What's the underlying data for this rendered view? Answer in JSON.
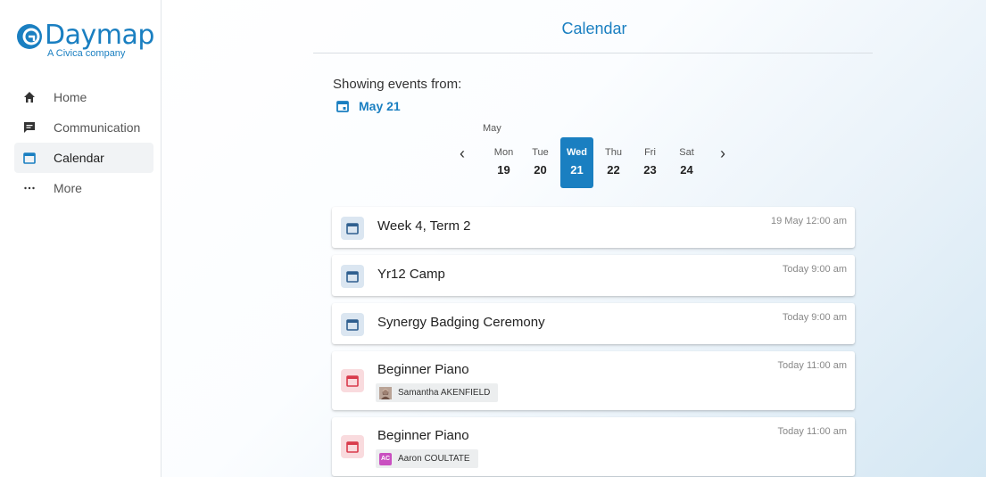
{
  "brand": {
    "name": "Daymap",
    "subtitle": "A Civica company",
    "color": "#1a7fc1"
  },
  "sidebar": {
    "items": [
      {
        "label": "Home",
        "icon": "home-icon",
        "active": false
      },
      {
        "label": "Communication",
        "icon": "message-icon",
        "active": false
      },
      {
        "label": "Calendar",
        "icon": "calendar-icon",
        "active": true
      },
      {
        "label": "More",
        "icon": "more-dots-icon",
        "active": false
      }
    ]
  },
  "main": {
    "title": "Calendar",
    "showing_label": "Showing events from:",
    "selected_date": "May 21",
    "month": "May",
    "days": [
      {
        "name": "Mon",
        "date": "19",
        "selected": false
      },
      {
        "name": "Tue",
        "date": "20",
        "selected": false
      },
      {
        "name": "Wed",
        "date": "21",
        "selected": true
      },
      {
        "name": "Thu",
        "date": "22",
        "selected": false
      },
      {
        "name": "Fri",
        "date": "23",
        "selected": false
      },
      {
        "name": "Sat",
        "date": "24",
        "selected": false
      }
    ],
    "prev_label": "‹",
    "next_label": "›",
    "events": [
      {
        "title": "Week 4, Term 2",
        "time": "19 May 12:00 am",
        "color": "blue"
      },
      {
        "title": "Yr12 Camp",
        "time": "Today 9:00 am",
        "color": "blue"
      },
      {
        "title": "Synergy Badging Ceremony",
        "time": "Today 9:00 am",
        "color": "blue"
      },
      {
        "title": "Beginner Piano",
        "time": "Today 11:00 am",
        "color": "red",
        "person": "Samantha AKENFIELD",
        "avatar_type": "photo"
      },
      {
        "title": "Beginner Piano",
        "time": "Today 11:00 am",
        "color": "red",
        "person": "Aaron COULTATE",
        "avatar_type": "initials",
        "initials": "AC"
      }
    ]
  },
  "colors": {
    "accent": "#1a7fc1",
    "event_blue_bg": "#dbe6f1",
    "event_red_bg": "#f9dbde",
    "event_red_icon": "#d93a4b",
    "event_blue_icon": "#2f5f8f"
  }
}
